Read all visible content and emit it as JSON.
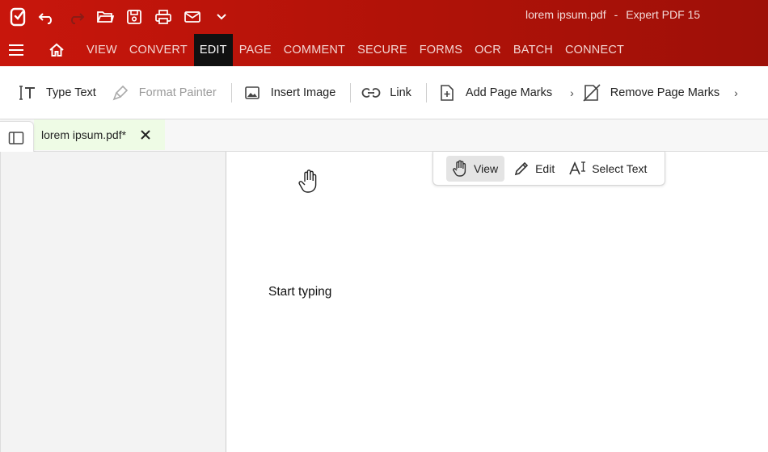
{
  "window": {
    "file_name": "lorem ipsum.pdf",
    "separator": "-",
    "app_name": "Expert PDF 15"
  },
  "quick_access": [
    "app-logo",
    "undo-icon",
    "redo-icon",
    "open-folder-icon",
    "save-icon",
    "print-icon",
    "mail-icon",
    "chevron-down-icon"
  ],
  "menu": {
    "items": [
      "VIEW",
      "CONVERT",
      "EDIT",
      "PAGE",
      "COMMENT",
      "SECURE",
      "FORMS",
      "OCR",
      "BATCH",
      "CONNECT"
    ],
    "active": "EDIT"
  },
  "ribbon": {
    "type_text": "Type Text",
    "format_painter": "Format Painter",
    "insert_image": "Insert Image",
    "link": "Link",
    "add_page_marks": "Add Page Marks",
    "remove_page_marks": "Remove Page Marks"
  },
  "tab": {
    "label": "lorem ipsum.pdf*"
  },
  "modes": {
    "view": "View",
    "edit": "Edit",
    "select_text": "Select Text",
    "active": "View"
  },
  "document": {
    "text": "Start typing"
  },
  "colors": {
    "brand_red": "#b01208",
    "active_menu": "#111111",
    "tab_bg": "#eefbe5"
  }
}
